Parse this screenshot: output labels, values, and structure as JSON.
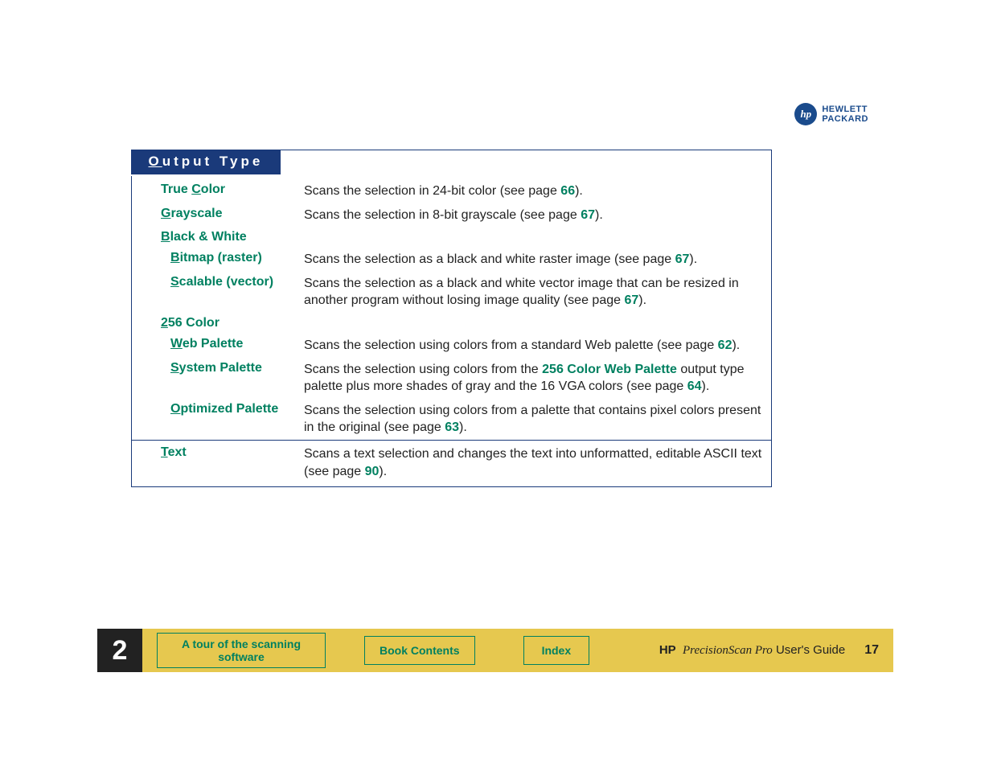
{
  "logo": {
    "hp": "hp",
    "line1": "HEWLETT",
    "line2": "PACKARD"
  },
  "section": {
    "prefix": "O",
    "rest": "utput Type"
  },
  "rows": {
    "true_color": {
      "u": "C",
      "before": "True ",
      "after": "olor",
      "desc_a": "Scans the selection in 24-bit color (see page ",
      "link": "66",
      "desc_b": ")."
    },
    "grayscale": {
      "u": "G",
      "before": "",
      "after": "rayscale",
      "desc_a": "Scans the selection in 8-bit grayscale (see page ",
      "link": "67",
      "desc_b": ")."
    },
    "bw": {
      "u": "B",
      "before": "",
      "after": "lack & White"
    },
    "bitmap": {
      "u": "B",
      "before": "",
      "after": "itmap (raster)",
      "desc_a": "Scans the selection as a black and white raster image (see page ",
      "link": "67",
      "desc_b": ")."
    },
    "scalable": {
      "u": "S",
      "before": "",
      "after": "calable (vector)",
      "desc_a": "Scans the selection as a black and white vector image that can be resized in another program without losing image quality (see page ",
      "link": "67",
      "desc_b": ")."
    },
    "c256": {
      "u": "2",
      "before": "",
      "after": "56 Color"
    },
    "web": {
      "u": "W",
      "before": "",
      "after": "eb Palette",
      "desc_a": "Scans the selection using colors from a standard Web palette (see page ",
      "link": "62",
      "desc_b": ")."
    },
    "system": {
      "u": "S",
      "before": "",
      "after": "ystem Palette",
      "desc_a": "Scans the selection using colors from the ",
      "link_inline": "256 Color Web Palette",
      "desc_mid": " output type palette plus more shades of gray and the 16 VGA colors (see page ",
      "link": "64",
      "desc_b": ")."
    },
    "optimized": {
      "u": "O",
      "before": "",
      "after": "ptimized Palette",
      "desc_a": "Scans the selection using colors from a palette that contains pixel colors present in the original (see page ",
      "link": "63",
      "desc_b": ")."
    },
    "text": {
      "u": "T",
      "before": "",
      "after": "ext",
      "desc_a": "Scans a text selection and changes the text into unformatted, editable ASCII text (see page ",
      "link": "90",
      "desc_b": ")."
    }
  },
  "footer": {
    "chapter": "2",
    "tour": "A tour of the scanning software",
    "contents": "Book Contents",
    "index": "Index",
    "hp": "HP",
    "product": "PrecisionScan Pro",
    "guide": " User's Guide",
    "page": "17"
  }
}
